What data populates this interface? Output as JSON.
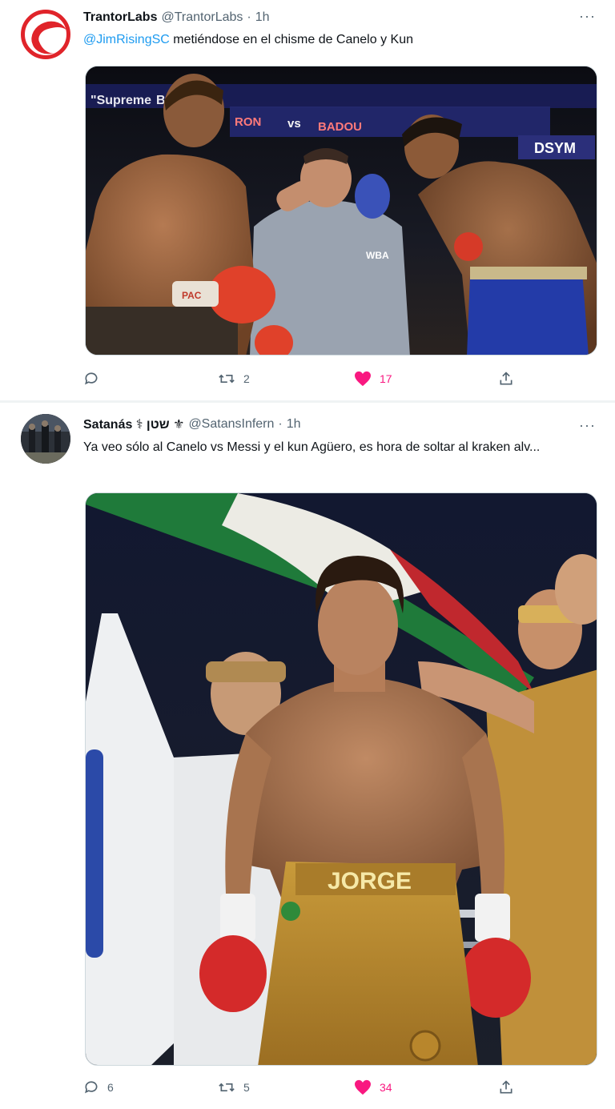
{
  "tweets": [
    {
      "author": {
        "name": "TrantorLabs",
        "handle": "@TrantorLabs",
        "time": "1h"
      },
      "text": {
        "mention": "@JimRisingSC",
        "body": " metiéndose en el chisme de Canelo y Kun"
      },
      "image": {
        "banner_1": "\"Supreme",
        "banner_2": "BOXING",
        "sign_1": "RON",
        "sign_2": "vs",
        "sign_3": "BADOU",
        "sign_4": "DSYM",
        "ref_badge": "WBA",
        "glove_brand": "PAC"
      },
      "stats": {
        "replies": "",
        "retweets": "2",
        "likes": "17"
      }
    },
    {
      "author": {
        "name": "Satanás ⚕ שטן ⚜",
        "handle": "@SatansInfern",
        "time": "1h"
      },
      "text": {
        "body": "Ya veo sólo al Canelo vs Messi y el kun Agüero, es hora de soltar al kraken alv..."
      },
      "image": {
        "shorts_text": "JORGE"
      },
      "stats": {
        "replies": "6",
        "retweets": "5",
        "likes": "34"
      }
    }
  ],
  "ui": {
    "more_glyph": "···",
    "dot": "·"
  },
  "colors": {
    "accent": "#1d9bf0",
    "like": "#f91880",
    "muted": "#536471",
    "brand_red": "#e0242a"
  },
  "icons": [
    "more-icon",
    "reply-icon",
    "retweet-icon",
    "heart-icon",
    "share-icon"
  ]
}
